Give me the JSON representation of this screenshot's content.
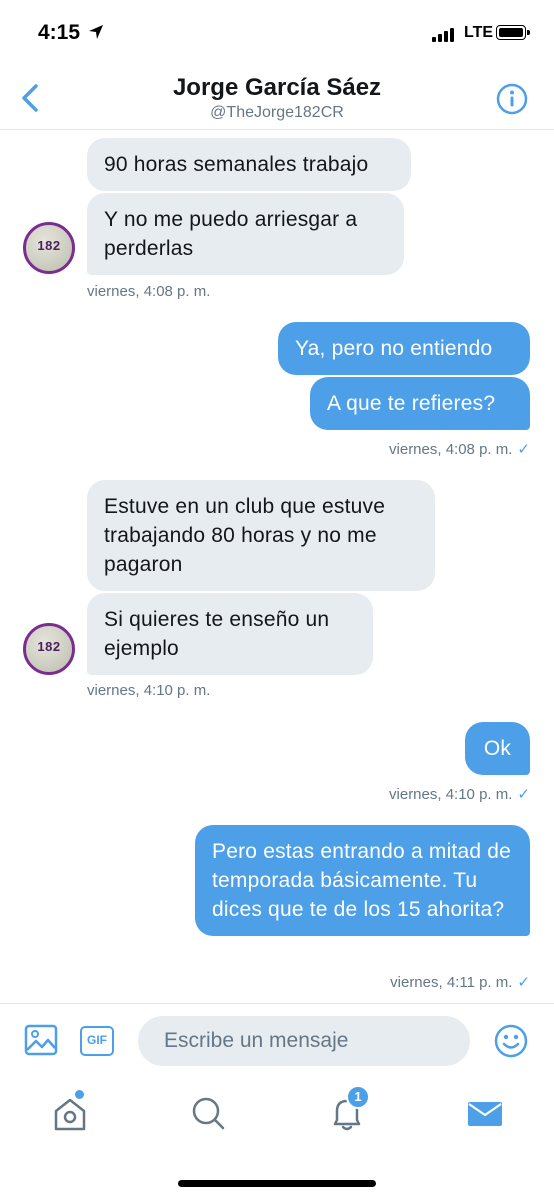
{
  "status_bar": {
    "time": "4:15",
    "network": "LTE"
  },
  "header": {
    "name": "Jorge García Sáez",
    "handle": "@TheJorge182CR",
    "back_icon": "chevron-left-icon",
    "info_icon": "info-icon"
  },
  "avatar_text": "182",
  "messages": [
    {
      "direction": "incoming",
      "text": "90 horas semanales trabajo"
    },
    {
      "direction": "incoming",
      "text": "Y no me puedo arriesgar a perderlas"
    },
    {
      "direction": "outgoing",
      "text": "Ya, pero no entiendo"
    },
    {
      "direction": "outgoing",
      "text": "A que te refieres?"
    },
    {
      "direction": "incoming",
      "text": "Estuve en un club que estuve trabajando 80 horas y no me pagaron"
    },
    {
      "direction": "incoming",
      "text": "Si quieres te enseño un ejemplo"
    },
    {
      "direction": "outgoing",
      "text": "Ok"
    },
    {
      "direction": "outgoing",
      "text": "Pero estas entrando a mitad de temporada básicamente. Tu dices que te de los 15 ahorita?"
    }
  ],
  "timestamps": [
    "viernes, 4:08 p. m.",
    "viernes, 4:08 p. m.",
    "viernes, 4:10 p. m.",
    "viernes, 4:10 p. m.",
    "viernes, 4:11 p. m."
  ],
  "read_mark": "✓",
  "composer": {
    "placeholder": "Escribe un mensaje",
    "gif_label": "GIF",
    "image_icon": "image-icon",
    "emoji_icon": "smiley-icon"
  },
  "tabbar": {
    "items": [
      "home-icon",
      "search-icon",
      "bell-icon",
      "mail-icon"
    ],
    "notification_count": "1",
    "active": "mail-icon"
  },
  "colors": {
    "accent": "#4d9fe8",
    "incoming_bubble": "#e6ecf0",
    "secondary_text": "#657786",
    "avatar_ring": "#7a2d8f"
  }
}
